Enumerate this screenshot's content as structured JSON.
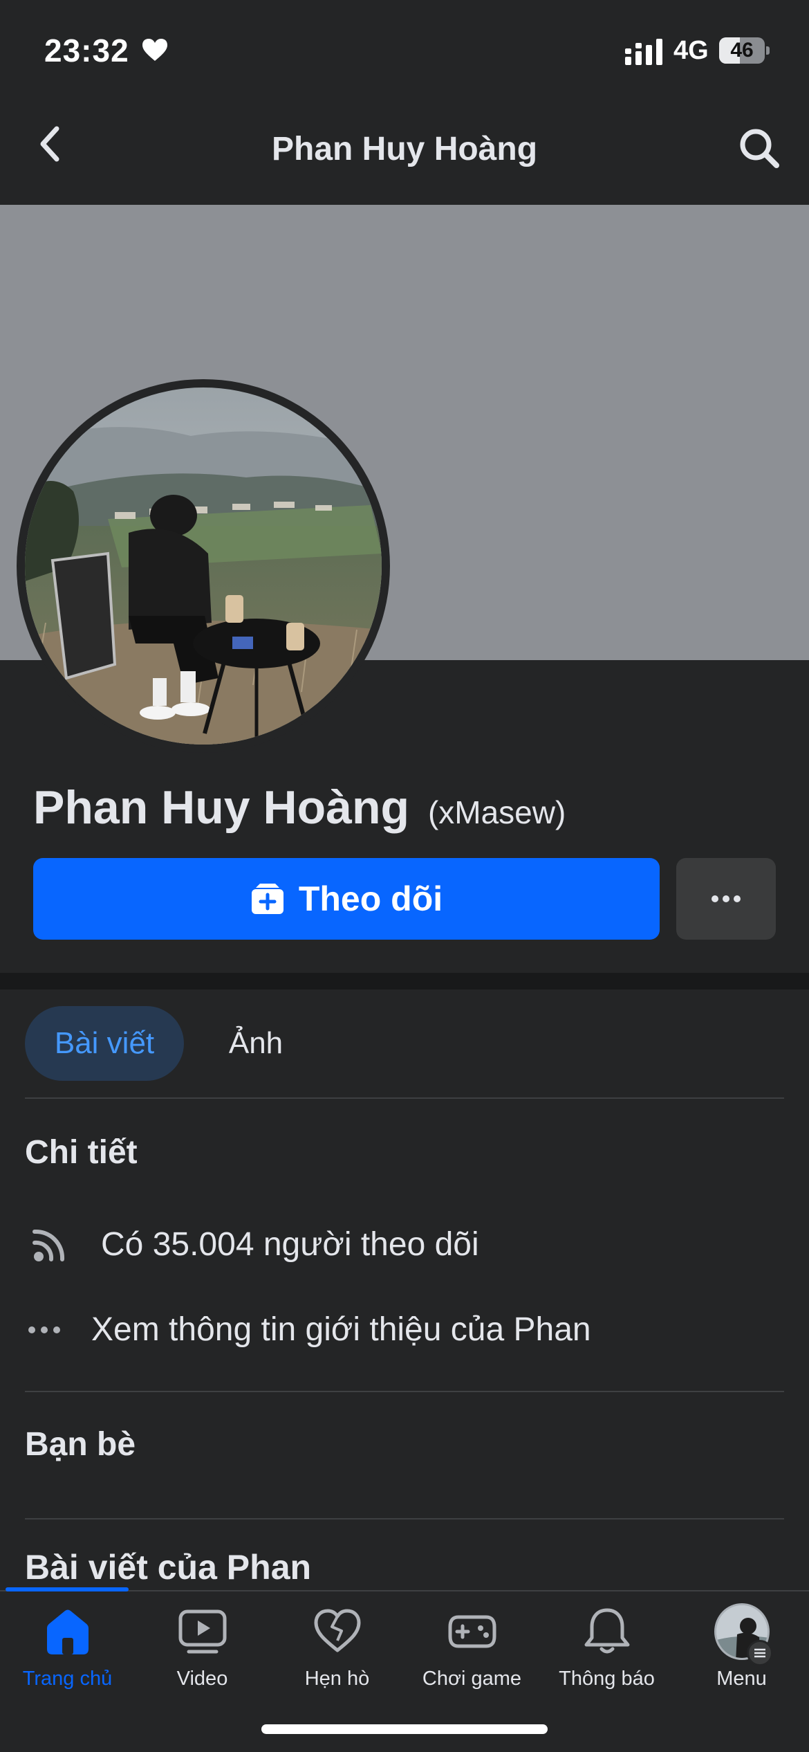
{
  "status_bar": {
    "time": "23:32",
    "network": "4G",
    "battery": "46",
    "battery_level": 0.46
  },
  "header": {
    "title": "Phan Huy Hoàng"
  },
  "profile": {
    "name": "Phan Huy Hoàng",
    "alias": "(xMasew)",
    "follow_label": "Theo dõi"
  },
  "tabs": {
    "posts": "Bài viết",
    "photos": "Ảnh"
  },
  "details": {
    "heading": "Chi tiết",
    "followers": "Có 35.004 người theo dõi",
    "about": "Xem thông tin giới thiệu của Phan"
  },
  "friends": {
    "heading": "Bạn bè"
  },
  "posts": {
    "heading": "Bài viết của Phan"
  },
  "tab_bar": {
    "items": [
      {
        "label": "Trang chủ",
        "icon": "home-icon",
        "active": true
      },
      {
        "label": "Video",
        "icon": "video-icon",
        "active": false
      },
      {
        "label": "Hẹn hò",
        "icon": "dating-heart-icon",
        "active": false
      },
      {
        "label": "Chơi game",
        "icon": "gaming-icon",
        "active": false
      },
      {
        "label": "Thông báo",
        "icon": "bell-icon",
        "active": false
      },
      {
        "label": "Menu",
        "icon": "menu-avatar",
        "active": false
      }
    ]
  },
  "colors": {
    "accent": "#0866ff",
    "background": "#242526",
    "cover": "#8d9095"
  }
}
